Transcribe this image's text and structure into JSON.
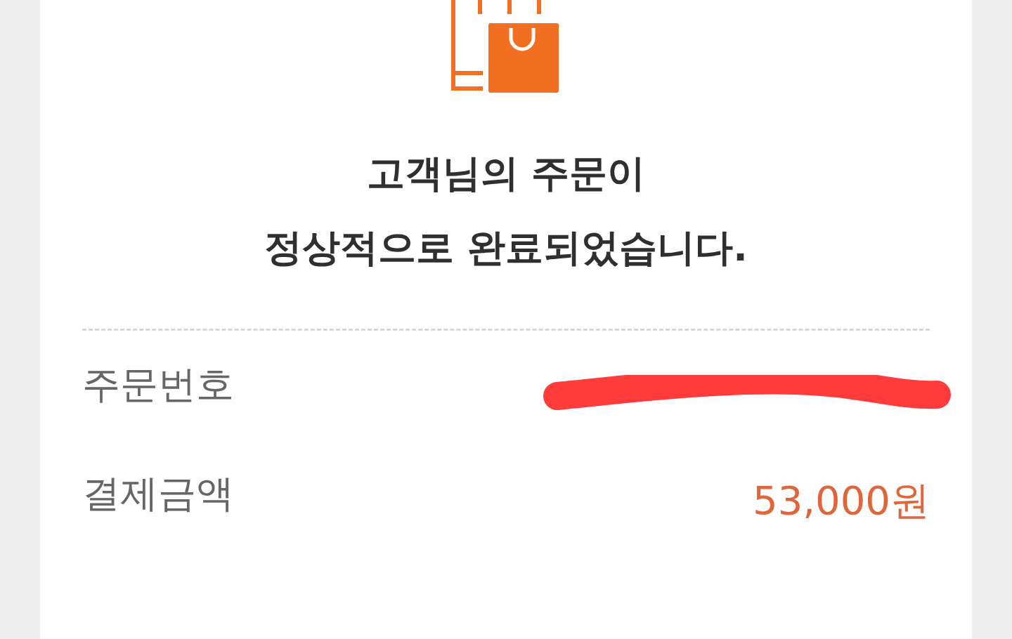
{
  "title_lines": [
    "고객님의 주문이",
    "정상적으로 완료되었습니다."
  ],
  "rows": [
    {
      "kind": "redacted",
      "label": "주문번호"
    },
    {
      "kind": "amount",
      "label": "결제금액",
      "value": "53,000원"
    }
  ]
}
